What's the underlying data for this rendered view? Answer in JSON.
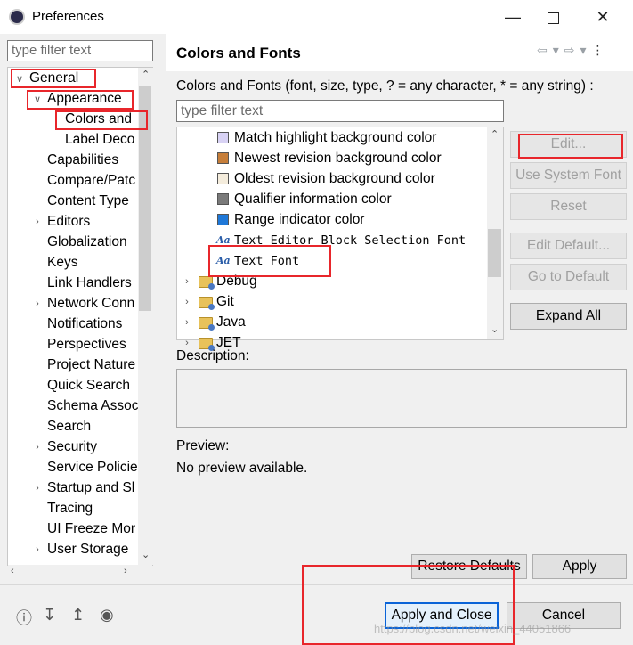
{
  "window": {
    "title": "Preferences",
    "min_icon": "minimize-icon",
    "max_icon": "maximize-icon",
    "close_icon": "close-icon"
  },
  "left": {
    "filter_placeholder": "type filter text",
    "tree": [
      {
        "label": "General",
        "twisty": "expanded"
      },
      {
        "label": "Appearance",
        "twisty": "expanded"
      },
      {
        "label": "Colors and",
        "twisty": ""
      },
      {
        "label": "Label Deco",
        "twisty": ""
      },
      {
        "label": "Capabilities",
        "twisty": ""
      },
      {
        "label": "Compare/Patc",
        "twisty": ""
      },
      {
        "label": "Content Type",
        "twisty": ""
      },
      {
        "label": "Editors",
        "twisty": "collapsed"
      },
      {
        "label": "Globalization",
        "twisty": ""
      },
      {
        "label": "Keys",
        "twisty": ""
      },
      {
        "label": "Link Handlers",
        "twisty": ""
      },
      {
        "label": "Network Conn",
        "twisty": "collapsed"
      },
      {
        "label": "Notifications",
        "twisty": ""
      },
      {
        "label": "Perspectives",
        "twisty": ""
      },
      {
        "label": "Project Nature",
        "twisty": ""
      },
      {
        "label": "Quick Search",
        "twisty": ""
      },
      {
        "label": "Schema Assoc",
        "twisty": ""
      },
      {
        "label": "Search",
        "twisty": ""
      },
      {
        "label": "Security",
        "twisty": "collapsed"
      },
      {
        "label": "Service Policie",
        "twisty": ""
      },
      {
        "label": "Startup and Sl",
        "twisty": "collapsed"
      },
      {
        "label": "Tracing",
        "twisty": ""
      },
      {
        "label": "UI Freeze Mor",
        "twisty": ""
      },
      {
        "label": "User Storage",
        "twisty": "collapsed"
      }
    ]
  },
  "right": {
    "title": "Colors and Fonts",
    "description": "Colors and Fonts (font, size, type, ? = any character, * = any string) :",
    "filter_placeholder": "type filter text",
    "items": [
      {
        "label": "Match highlight background color",
        "kind": "color",
        "color": "#d8d2f4"
      },
      {
        "label": "Newest revision background color",
        "kind": "color",
        "color": "#c67e3a"
      },
      {
        "label": "Oldest revision background color",
        "kind": "color",
        "color": "#f4ecdc"
      },
      {
        "label": "Qualifier information color",
        "kind": "color",
        "color": "#7a7a7a"
      },
      {
        "label": "Range indicator color",
        "kind": "color",
        "color": "#1f78d8"
      },
      {
        "label": "Text Editor Block Selection Font",
        "kind": "font"
      },
      {
        "label": "Text Font",
        "kind": "font"
      },
      {
        "label": "Debug",
        "kind": "folder"
      },
      {
        "label": "Git",
        "kind": "folder"
      },
      {
        "label": "Java",
        "kind": "folder"
      },
      {
        "label": "JET",
        "kind": "folder"
      }
    ],
    "buttons": {
      "edit": "Edit...",
      "use_system_font": "Use System Font",
      "reset": "Reset",
      "edit_default": "Edit Default...",
      "go_to_default": "Go to Default",
      "expand_all": "Expand All"
    },
    "description_label": "Description:",
    "preview_label": "Preview:",
    "preview_text": "No preview available.",
    "restore_defaults": "Restore Defaults",
    "apply": "Apply"
  },
  "footer": {
    "apply_and_close": "Apply and Close",
    "cancel": "Cancel",
    "icons": [
      "help-icon",
      "import-icon",
      "export-icon",
      "record-icon"
    ]
  },
  "watermark": "https://blog.csdn.net/weixin_44051866"
}
